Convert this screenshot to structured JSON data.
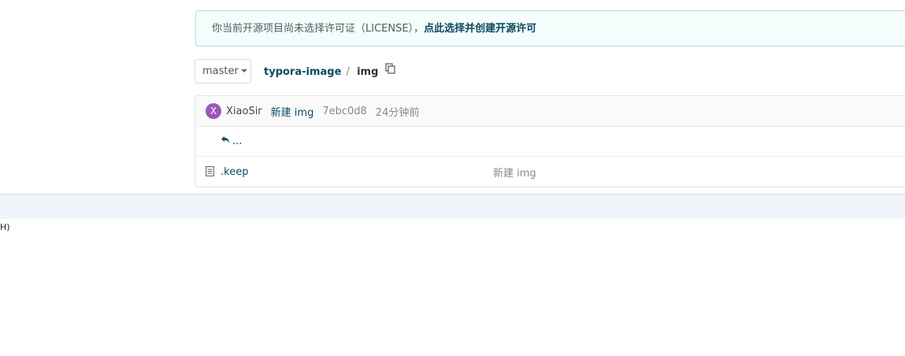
{
  "license_notice": {
    "message": "你当前开源项目尚未选择许可证（LICENSE），",
    "link_label": "点此选择并创建开源许可"
  },
  "branch": {
    "label": "master"
  },
  "breadcrumb": {
    "repo": "typora-image",
    "separator": "/",
    "current": "img"
  },
  "commit": {
    "avatar_letter": "X",
    "author": "XiaoSir",
    "message": "新建 img",
    "hash": "7ebc0d8",
    "time": "24分钟前"
  },
  "parent_row": {
    "label": "..."
  },
  "files": [
    {
      "name": ".keep",
      "commit_message": "新建 img"
    }
  ],
  "bottom_text": "H)",
  "colors": {
    "link": "#0b4a60",
    "avatar": "#9b59b6",
    "notice_bg": "#f4fcfc",
    "notice_border": "#b3dcdc",
    "bottom_bar": "#f1f4fa"
  }
}
